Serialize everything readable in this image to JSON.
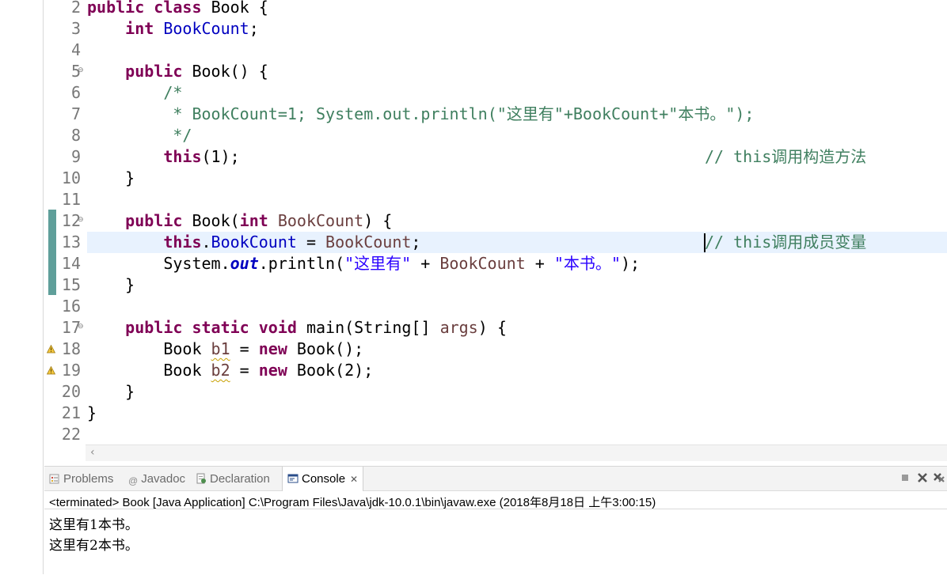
{
  "editor": {
    "lines": [
      {
        "n": "2"
      },
      {
        "n": "3"
      },
      {
        "n": "4"
      },
      {
        "n": "5"
      },
      {
        "n": "6"
      },
      {
        "n": "7"
      },
      {
        "n": "8"
      },
      {
        "n": "9"
      },
      {
        "n": "10"
      },
      {
        "n": "11"
      },
      {
        "n": "12"
      },
      {
        "n": "13"
      },
      {
        "n": "14"
      },
      {
        "n": "15"
      },
      {
        "n": "16"
      },
      {
        "n": "17"
      },
      {
        "n": "18"
      },
      {
        "n": "19"
      },
      {
        "n": "20"
      },
      {
        "n": "21"
      },
      {
        "n": "22"
      }
    ],
    "t": {
      "public": "public",
      "class": "class",
      "Book": "Book",
      "lbrace": " {",
      "rbrace": "}",
      "int": "int",
      "BookCount": "BookCount",
      "semi": ";",
      "ctor_open": " Book() {",
      "cmt_open": "/*",
      "cmt_body": " * BookCount=1; System.out.println(\"这里有\"+BookCount+\"本书。\");",
      "cmt_close": " */",
      "this": "this",
      "this_call_args": "(1);",
      "cmt_9": "// this调用构造方法",
      "ctor2_a": " Book(",
      "ctor2_b": " ",
      "ctor2_c": ") {",
      "dot": ".",
      "assign": " = ",
      "cmt_13": "// this调用成员变量",
      "System": "System",
      "out": "out",
      "println_open": ".println(",
      "str1": "\"这里有\"",
      "plus1": " + ",
      "plus2": " + ",
      "str2": "\"本书。\"",
      "close_paren": ");",
      "static": "static",
      "void": "void",
      "main_sig": " main(String[] ",
      "args": "args",
      "main_close": ") {",
      "b1": "b1",
      "b2": "b2",
      "new": "new",
      "book_call1": " Book();",
      "book_call2": " Book(2);",
      "eq": " = "
    }
  },
  "panel": {
    "tabs": [
      {
        "label": "Problems"
      },
      {
        "label": "Javadoc"
      },
      {
        "label": "Declaration"
      },
      {
        "label": "Console"
      }
    ],
    "status": "<terminated> Book [Java Application] C:\\Program Files\\Java\\jdk-10.0.1\\bin\\javaw.exe (2018年8月18日 上午3:00:15)",
    "output": [
      "这里有1本书。",
      "这里有2本书。"
    ]
  },
  "colors": {
    "keyword": "#7f0055",
    "field": "#0000c0",
    "string": "#2a00ff",
    "comment": "#3f7f5f",
    "current_line": "#e8f2fe"
  },
  "icons": [
    "collapse-icon",
    "warning-icon",
    "problems-icon",
    "javadoc-icon",
    "declaration-icon",
    "console-icon",
    "stop-icon",
    "remove-launch-icon",
    "remove-all-icon"
  ]
}
